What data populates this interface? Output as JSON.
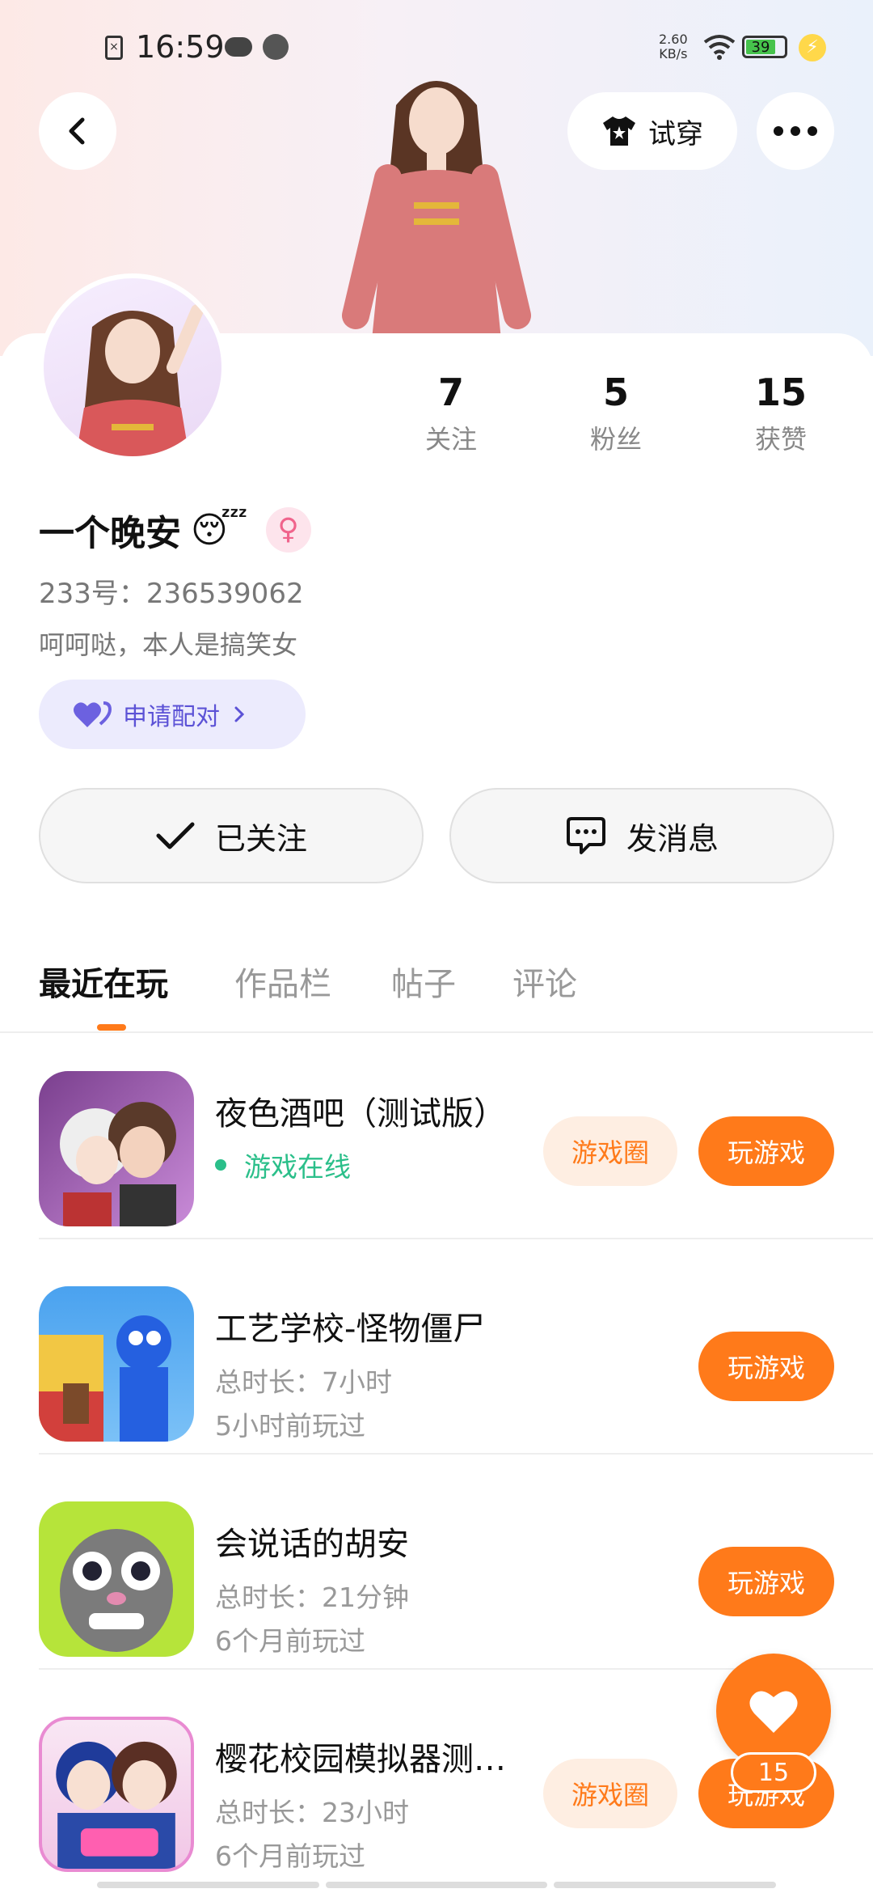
{
  "status_bar": {
    "time": "16:59",
    "net_speed_value": "2.60",
    "net_speed_unit": "KB/s",
    "battery": "39"
  },
  "header": {
    "try_on_label": "试穿"
  },
  "profile": {
    "name": "一个晚安",
    "name_emoji": "😴",
    "gender_symbol": "♀",
    "uid": "233号：236539062",
    "bio": "呵呵哒，本人是搞笑女",
    "pair_label": "申请配对",
    "stats": [
      {
        "num": "7",
        "label": "关注"
      },
      {
        "num": "5",
        "label": "粉丝"
      },
      {
        "num": "15",
        "label": "获赞"
      }
    ]
  },
  "actions": {
    "follow_label": "已关注",
    "message_label": "发消息"
  },
  "tabs": [
    "最近在玩",
    "作品栏",
    "帖子",
    "评论"
  ],
  "games": [
    {
      "title": "夜色酒吧（测试版）",
      "online": "游戏在线",
      "circle_label": "游戏圈",
      "play_label": "玩游戏"
    },
    {
      "title": "工艺学校-怪物僵尸",
      "duration": "总时长：7小时",
      "last_played": "5小时前玩过",
      "play_label": "玩游戏"
    },
    {
      "title": "会说话的胡安",
      "duration": "总时长：21分钟",
      "last_played": "6个月前玩过",
      "play_label": "玩游戏"
    },
    {
      "title": "樱花校园模拟器测…",
      "duration": "总时长：23小时",
      "last_played": "6个月前玩过",
      "circle_label": "游戏圈",
      "play_label": "玩游戏"
    }
  ],
  "like_count": "15",
  "colors": {
    "accent": "#ff7a1a",
    "online": "#2bbf8a",
    "pair": "#5c52d6"
  }
}
